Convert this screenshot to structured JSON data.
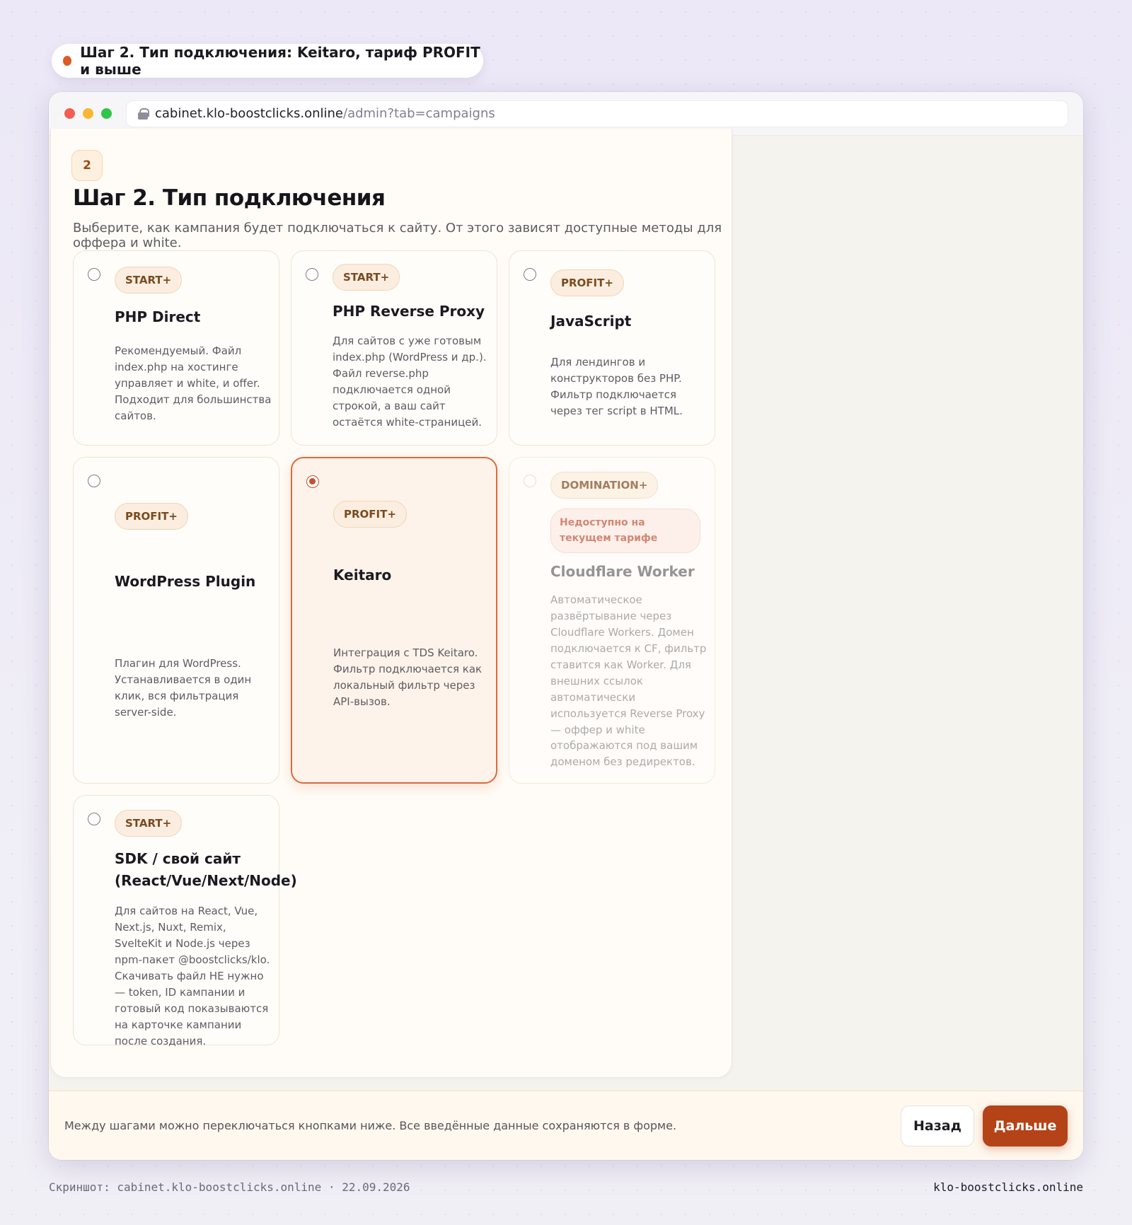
{
  "caption": {
    "text": "Шаг 2. Тип подключения: Keitaro, тариф PROFIT и выше"
  },
  "browser": {
    "url_host": "cabinet.klo-boostclicks.online",
    "url_path": "/admin?tab=campaigns"
  },
  "step": {
    "number": "2",
    "title": "Шаг 2. Тип подключения",
    "description": "Выберите, как кампания будет подключаться к сайту. От этого зависят доступные методы для оффера и white."
  },
  "options": [
    {
      "badge": "START+",
      "title": "PHP Direct",
      "description": "Рекомендуемый. Файл index.php на хостинге управляет и white, и offer. Подходит для большинства сайтов.",
      "state": "default"
    },
    {
      "badge": "START+",
      "title": "PHP Reverse Proxy",
      "description": "Для сайтов с уже готовым index.php (WordPress и др.). Файл reverse.php подключается одной строкой, а ваш сайт остаётся white-страницей.",
      "state": "default"
    },
    {
      "badge": "PROFIT+",
      "title": "JavaScript",
      "description": "Для лендингов и конструкторов без PHP. Фильтр подключается через тег script в HTML.",
      "state": "default"
    },
    {
      "badge": "PROFIT+",
      "title": "WordPress Plugin",
      "description": "Плагин для WordPress. Устанавливается в один клик, вся фильтрация server-side.",
      "state": "default"
    },
    {
      "badge": "PROFIT+",
      "title": "Keitaro",
      "description": "Интеграция с TDS Keitaro. Фильтр подключается как локальный фильтр через API-вызов.",
      "state": "selected"
    },
    {
      "badge": "DOMINATION+",
      "unavailable": "Недоступно на текущем тарифе",
      "title": "Cloudflare Worker",
      "description": "Автоматическое развёртывание через Cloudflare Workers. Домен подключается к CF, фильтр ставится как Worker. Для внешних ссылок автоматически используется Reverse Proxy — оффер и white отображаются под вашим доменом без редиректов.",
      "state": "disabled"
    },
    {
      "badge": "START+",
      "title": "SDK / свой сайт (React/Vue/Next/Node)",
      "description": "Для сайтов на React, Vue, Next.js, Nuxt, Remix, SvelteKit и Node.js через npm-пакет @boostclicks/klo. Скачивать файл НЕ нужно — token, ID кампании и готовый код показываются на карточке кампании после создания.",
      "state": "default"
    }
  ],
  "footer": {
    "hint": "Между шагами можно переключаться кнопками ниже. Все введённые данные сохраняются в форме.",
    "back_label": "Назад",
    "next_label": "Дальше"
  },
  "screenshot_note": "Скриншот: cabinet.klo-boostclicks.online · 22.09.2026",
  "domain_label": "klo-boostclicks.online",
  "colors": {
    "accent": "#b54318",
    "selected_border": "#dc6b3c",
    "badge_bg": "#fbeee0",
    "unavailable_text": "#c2553a"
  }
}
